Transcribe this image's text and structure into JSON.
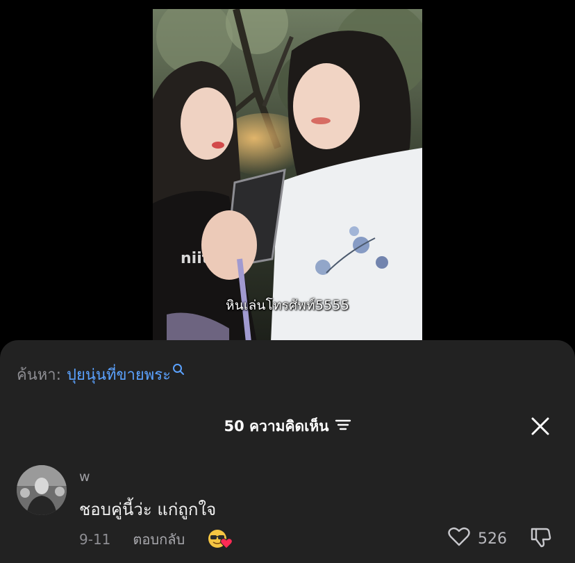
{
  "video": {
    "caption": "หินเล่นโทรศัพท์5555"
  },
  "search": {
    "prefix": "ค้นหา:",
    "term": "ปุยนุ่นที่ขายพระ"
  },
  "comments_header": {
    "title": "50 ความคิดเห็น"
  },
  "comment": {
    "username": "w",
    "text": "ชอบคู่นี้ว่ะ แก่ถูกใจ",
    "date": "9-11",
    "reply_label": "ตอบกลับ",
    "like_count": "526",
    "icons": [
      "sunglasses-face-icon",
      "heart-icon",
      "dislike-icon"
    ]
  },
  "colors": {
    "sheet_bg": "#222222",
    "search_term": "#5ba2ff",
    "muted_text": "#8e8e93",
    "primary_text": "#f2f2f2"
  }
}
